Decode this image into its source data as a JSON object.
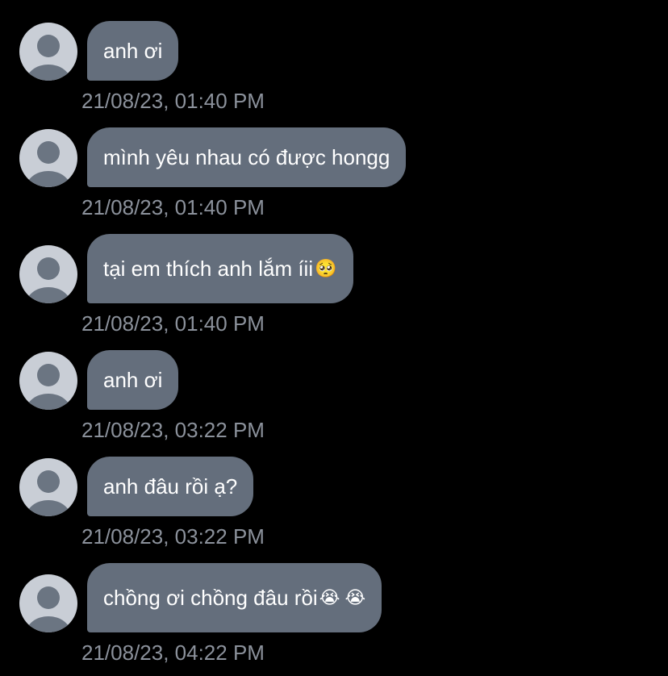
{
  "conversation": {
    "messages": [
      {
        "text": "anh ơi",
        "emoji": "",
        "timestamp": "21/08/23, 01:40 PM"
      },
      {
        "text": "mình yêu nhau có được hongg",
        "emoji": "",
        "timestamp": "21/08/23, 01:40 PM"
      },
      {
        "text": "tại em thích anh lắm íii",
        "emoji": "🥺",
        "timestamp": "21/08/23, 01:40 PM"
      },
      {
        "text": "anh ơi",
        "emoji": "",
        "timestamp": "21/08/23, 03:22 PM"
      },
      {
        "text": "anh đâu rồi ạ?",
        "emoji": "",
        "timestamp": "21/08/23, 03:22 PM"
      },
      {
        "text": "chồng ơi chồng đâu rồi",
        "emoji": "😭 😭",
        "timestamp": "21/08/23, 04:22 PM"
      }
    ]
  },
  "colors": {
    "background": "#000000",
    "bubble": "#646e7c",
    "bubble_text": "#ffffff",
    "timestamp": "#8b919b",
    "avatar_bg": "#c9ced6",
    "avatar_figure": "#6b7582"
  },
  "icons": {
    "avatar": "default-user-avatar-icon"
  }
}
